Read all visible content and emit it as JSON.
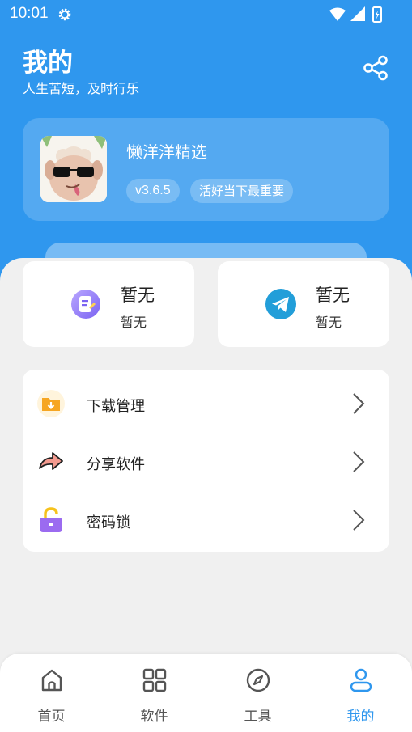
{
  "colors": {
    "brand": "#2f97ee",
    "background": "#f0f0f0",
    "card": "#ffffff"
  },
  "status_bar": {
    "time": "10:01",
    "icons": [
      "gear-icon",
      "wifi-icon",
      "signal-icon",
      "battery-charging-icon"
    ]
  },
  "header": {
    "title": "我的",
    "subtitle": "人生苦短，及时行乐",
    "action_icon": "share-icon"
  },
  "app_card": {
    "name": "懒洋洋精选",
    "version": "v3.6.5",
    "motto": "活好当下最重要",
    "avatar_icon": "sheep-avatar"
  },
  "stats": [
    {
      "value": "暂无",
      "label": "暂无",
      "icon": "notes-app-icon"
    },
    {
      "value": "暂无",
      "label": "暂无",
      "icon": "telegram-icon"
    }
  ],
  "menu": [
    {
      "label": "下载管理",
      "icon": "download-folder-icon"
    },
    {
      "label": "分享软件",
      "icon": "share-arrow-icon"
    },
    {
      "label": "密码锁",
      "icon": "padlock-icon"
    }
  ],
  "tabs": [
    {
      "label": "首页",
      "icon": "home-icon",
      "active": false
    },
    {
      "label": "软件",
      "icon": "grid-icon",
      "active": false
    },
    {
      "label": "工具",
      "icon": "compass-icon",
      "active": false
    },
    {
      "label": "我的",
      "icon": "user-icon",
      "active": true
    }
  ]
}
